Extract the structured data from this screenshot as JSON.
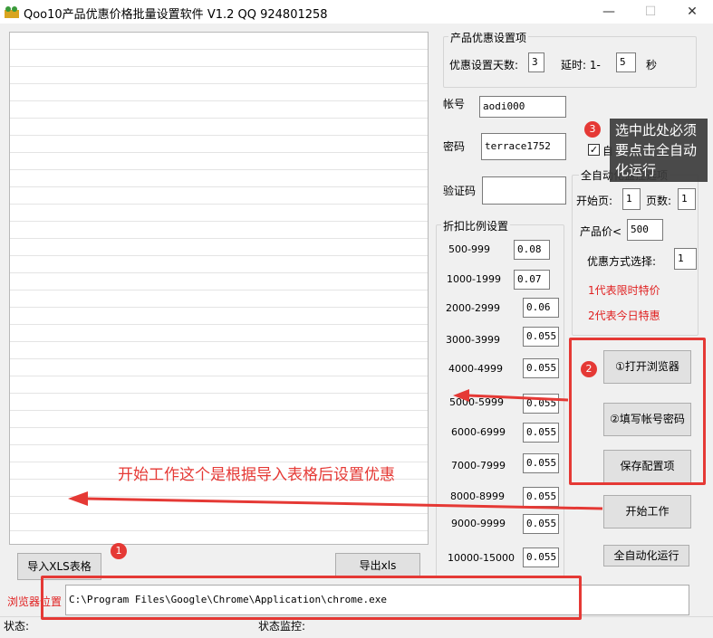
{
  "window": {
    "title": "Qoo10产品优惠价格批量设置软件 V1.2 QQ 924801258",
    "minimize_glyph": "—",
    "maximize_glyph": "☐",
    "close_glyph": "✕"
  },
  "discount_settings": {
    "group_title": "产品优惠设置项",
    "days_label": "优惠设置天数:",
    "days_value": "3",
    "delay_label": "延时: 1-",
    "delay_value": "5",
    "delay_unit": "秒"
  },
  "account": {
    "username_label": "帐号",
    "username_value": "aodi000",
    "password_label": "密码",
    "password_value": "terrace1752",
    "captcha_label": "验证码",
    "captcha_value": ""
  },
  "ratio": {
    "group_title": "折扣比例设置",
    "rows": [
      {
        "range": "500-999",
        "value": "0.08"
      },
      {
        "range": "1000-1999",
        "value": "0.07"
      },
      {
        "range": "2000-2999",
        "value": "0.06"
      },
      {
        "range": "3000-3999",
        "value": "0.055"
      },
      {
        "range": "4000-4999",
        "value": "0.055"
      },
      {
        "range": "5000-5999",
        "value": "0.055"
      },
      {
        "range": "6000-6999",
        "value": "0.055"
      },
      {
        "range": "7000-7999",
        "value": "0.055"
      },
      {
        "range": "8000-8999",
        "value": "0.055"
      },
      {
        "range": "9000-9999",
        "value": "0.055"
      },
      {
        "range": "10000-15000",
        "value": "0.055"
      }
    ]
  },
  "auto": {
    "checkbox_label": "自",
    "group_title": "全自动化监控选项",
    "start_page_label": "开始页:",
    "start_page_value": "1",
    "page_count_label": "页数:",
    "page_count_value": "1",
    "price_label": "产品价<",
    "price_value": "500",
    "mode_label": "优惠方式选择:",
    "mode_value": "1",
    "mode_hint_1": "1代表限时特价",
    "mode_hint_2": "2代表今日特惠"
  },
  "buttons": {
    "open_browser": "①打开浏览器",
    "fill_account": "②填写帐号密码",
    "save_config": "保存配置项",
    "start_work": "开始工作",
    "auto_run": "全自动化运行",
    "import_xls": "导入XLS表格",
    "export_xls": "导出xls"
  },
  "browser": {
    "label": "浏览器位置",
    "path": "C:\\Program Files\\Google\\Chrome\\Application\\chrome.exe"
  },
  "status": {
    "status_label": "状态:",
    "monitor_label": "状态监控:"
  },
  "annotations": {
    "badge_1": "1",
    "badge_2": "2",
    "badge_3": "3",
    "tooltip": "选中此处必须要点击全自动化运行",
    "start_note": "开始工作这个是根据导入表格后设置优惠"
  },
  "colors": {
    "annotation_red": "#e53935",
    "hint_red": "#e02020"
  }
}
